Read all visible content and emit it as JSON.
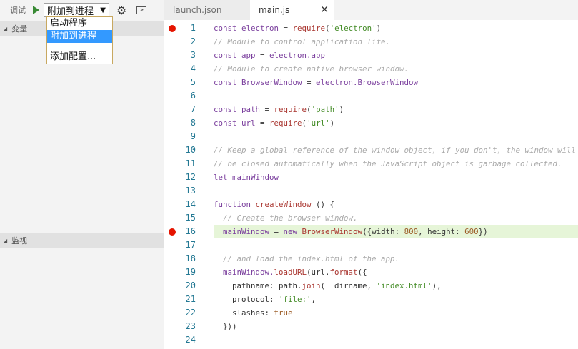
{
  "toolbar": {
    "debug_label": "调试",
    "config_selected": "附加到进程",
    "dropdown_arrow": "▼",
    "gear_icon": "gear-icon",
    "terminal_icon": "terminal-icon"
  },
  "dropdown": {
    "items": [
      "启动程序",
      "附加到进程"
    ],
    "add_config": "添加配置..."
  },
  "sections": {
    "variables": "变量",
    "watch": "监视"
  },
  "tabs": [
    {
      "label": "launch.json"
    },
    {
      "label": "main.js",
      "close": "✕"
    }
  ],
  "colors": {
    "breakpoint": "#e51400",
    "highlight": "#e6f5d8",
    "line_number": "#237893"
  },
  "code": [
    {
      "n": "1",
      "bp": true,
      "t": [
        [
          "kw",
          "const electron "
        ],
        [
          "pl",
          "= "
        ],
        [
          "fn",
          "require"
        ],
        [
          "pl",
          "("
        ],
        [
          "str",
          "'electron'"
        ],
        [
          "pl",
          ")"
        ]
      ]
    },
    {
      "n": "2",
      "t": [
        [
          "cm",
          "// Module to control application life."
        ]
      ]
    },
    {
      "n": "3",
      "t": [
        [
          "kw",
          "const app "
        ],
        [
          "pl",
          "= "
        ],
        [
          "id",
          "electron.app"
        ]
      ]
    },
    {
      "n": "4",
      "t": [
        [
          "cm",
          "// Module to create native browser window."
        ]
      ]
    },
    {
      "n": "5",
      "t": [
        [
          "kw",
          "const BrowserWindow "
        ],
        [
          "pl",
          "= "
        ],
        [
          "id",
          "electron.BrowserWindow"
        ]
      ]
    },
    {
      "n": "6",
      "t": []
    },
    {
      "n": "7",
      "t": [
        [
          "kw",
          "const path "
        ],
        [
          "pl",
          "= "
        ],
        [
          "fn",
          "require"
        ],
        [
          "pl",
          "("
        ],
        [
          "str",
          "'path'"
        ],
        [
          "pl",
          ")"
        ]
      ]
    },
    {
      "n": "8",
      "t": [
        [
          "kw",
          "const url "
        ],
        [
          "pl",
          "= "
        ],
        [
          "fn",
          "require"
        ],
        [
          "pl",
          "("
        ],
        [
          "str",
          "'url'"
        ],
        [
          "pl",
          ")"
        ]
      ]
    },
    {
      "n": "9",
      "t": []
    },
    {
      "n": "10",
      "t": [
        [
          "cm",
          "// Keep a global reference of the window object, if you don't, the window will"
        ]
      ]
    },
    {
      "n": "11",
      "t": [
        [
          "cm",
          "// be closed automatically when the JavaScript object is garbage collected."
        ]
      ]
    },
    {
      "n": "12",
      "t": [
        [
          "kw",
          "let mainWindow"
        ]
      ]
    },
    {
      "n": "13",
      "t": []
    },
    {
      "n": "14",
      "t": [
        [
          "kw",
          "function "
        ],
        [
          "fn",
          "createWindow"
        ],
        [
          "pl",
          " () {"
        ]
      ]
    },
    {
      "n": "15",
      "t": [
        [
          "cm",
          "  // Create the browser window."
        ]
      ]
    },
    {
      "n": "16",
      "bp": true,
      "hl": true,
      "t": [
        [
          "id",
          "  mainWindow "
        ],
        [
          "pl",
          "= "
        ],
        [
          "kw",
          "new "
        ],
        [
          "fn",
          "BrowserWindow"
        ],
        [
          "pl",
          "({width: "
        ],
        [
          "num",
          "800"
        ],
        [
          "pl",
          ", height: "
        ],
        [
          "num",
          "600"
        ],
        [
          "pl",
          "})"
        ]
      ]
    },
    {
      "n": "17",
      "t": []
    },
    {
      "n": "18",
      "t": [
        [
          "cm",
          "  // and load the index.html of the app."
        ]
      ]
    },
    {
      "n": "19",
      "t": [
        [
          "id",
          "  mainWindow."
        ],
        [
          "fn",
          "loadURL"
        ],
        [
          "pl",
          "(url."
        ],
        [
          "fn",
          "format"
        ],
        [
          "pl",
          "({"
        ]
      ]
    },
    {
      "n": "20",
      "t": [
        [
          "pl",
          "    pathname: path."
        ],
        [
          "fn",
          "join"
        ],
        [
          "pl",
          "(__dirname, "
        ],
        [
          "str",
          "'index.html'"
        ],
        [
          "pl",
          "),"
        ]
      ]
    },
    {
      "n": "21",
      "t": [
        [
          "pl",
          "    protocol: "
        ],
        [
          "str",
          "'file:'"
        ],
        [
          "pl",
          ","
        ]
      ]
    },
    {
      "n": "22",
      "t": [
        [
          "pl",
          "    slashes: "
        ],
        [
          "num",
          "true"
        ]
      ]
    },
    {
      "n": "23",
      "t": [
        [
          "pl",
          "  }))"
        ]
      ]
    },
    {
      "n": "24",
      "t": []
    }
  ]
}
